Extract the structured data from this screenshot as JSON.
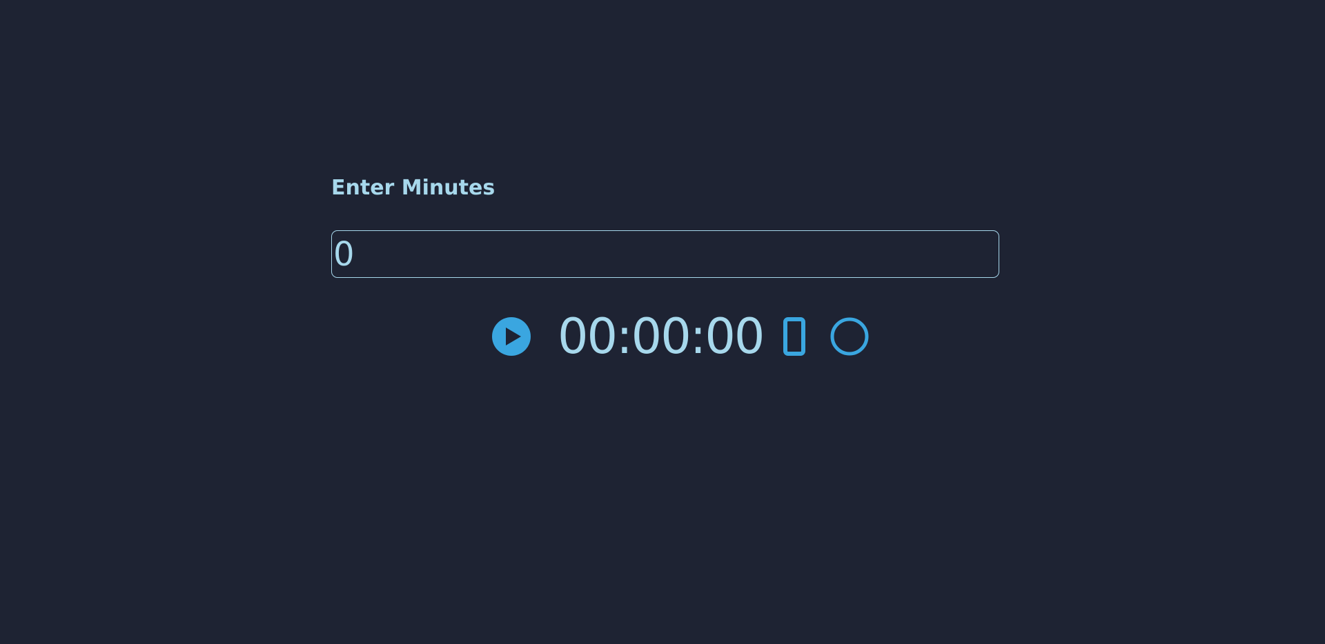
{
  "timer": {
    "label": "Enter Minutes",
    "minutes_value": "0",
    "display": "00:00:00"
  },
  "controls": {
    "play_icon": "play-circle-icon",
    "pause_icon": "pause-rect-icon",
    "reset_icon": "reset-circle-icon"
  },
  "colors": {
    "background": "#1e2333",
    "text": "#a7d8ec",
    "accent": "#3aa6e0"
  }
}
